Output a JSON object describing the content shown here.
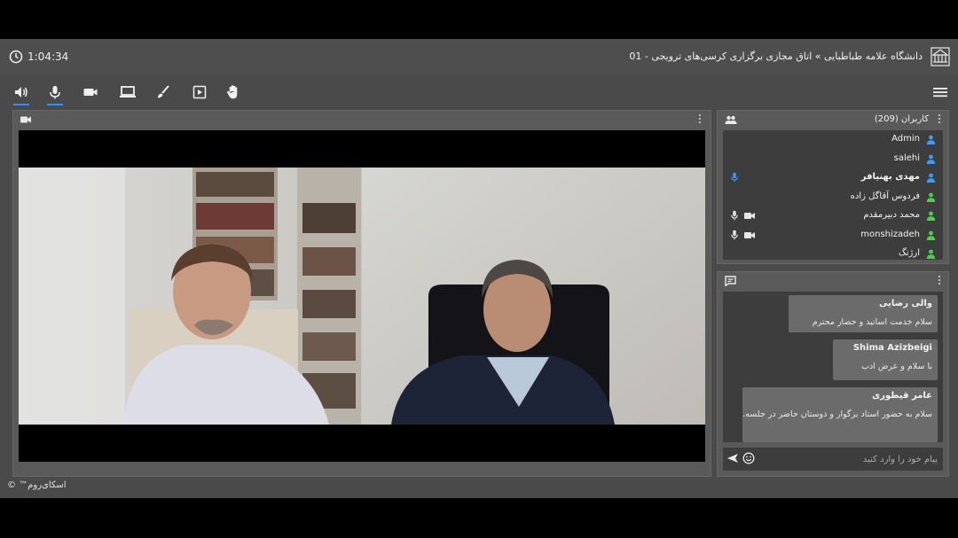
{
  "header": {
    "timer": "1:04:34",
    "room_title": "دانشگاه علامه طباطبایی » اتاق مجازی برگزاری کرسی‌های ترویجی - 01"
  },
  "toolbar": {
    "tools": [
      "speaker-icon",
      "microphone-icon",
      "camera-icon",
      "screen-share-icon",
      "whiteboard-brush-icon",
      "media-player-icon",
      "raise-hand-icon"
    ]
  },
  "users": {
    "title": "کاربران (209)",
    "items": [
      {
        "name": "Admin",
        "color": "#3b9bff",
        "bold": false,
        "mic": false,
        "cam": false
      },
      {
        "name": "salehi",
        "color": "#3b9bff",
        "bold": false,
        "mic": false,
        "cam": false
      },
      {
        "name": "مهدی بهنیافر",
        "color": "#3b9bff",
        "bold": true,
        "mic": true,
        "cam": false
      },
      {
        "name": "فردوس آقاگل زاده",
        "color": "#4cd04c",
        "bold": false,
        "mic": false,
        "cam": false
      },
      {
        "name": "محمد دبیرمقدم",
        "color": "#4cd04c",
        "bold": false,
        "mic": true,
        "cam": true
      },
      {
        "name": "monshizadeh",
        "color": "#4cd04c",
        "bold": false,
        "mic": true,
        "cam": true
      },
      {
        "name": "ارژنگ",
        "color": "#4cd04c",
        "bold": false,
        "mic": false,
        "cam": false
      }
    ]
  },
  "chat": {
    "messages": [
      {
        "author": "والی رضایی",
        "text": "سلام خدمت اساتید و حضار محترم"
      },
      {
        "author": "Shima Azizbeigi",
        "text": "با سلام و عرض ادب"
      },
      {
        "author": "عامر قیطوری",
        "text": "سلام به حضور استاد بزگوار و دوستان حاضر در جلسه."
      }
    ],
    "input_placeholder": "پیام خود را وارد کنید"
  },
  "footer": {
    "brand": "اسکای‌روم™ ©"
  },
  "colors": {
    "accent": "#2f8fff",
    "presenter": "#3b9bff",
    "participant": "#4cd04c"
  }
}
